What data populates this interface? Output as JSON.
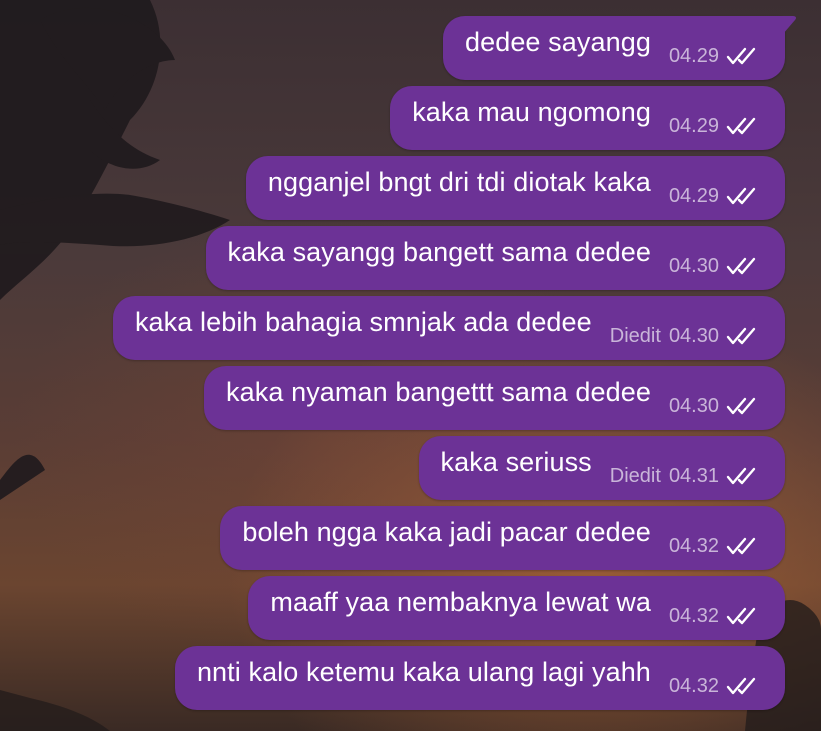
{
  "chat": {
    "read_status_icon": "double-check-icon",
    "bubble_color": "#6c3296",
    "meta_color": "#c9b5d9",
    "messages": [
      {
        "text": "dedee sayangg",
        "time": "04.29",
        "edited": ""
      },
      {
        "text": "kaka mau ngomong",
        "time": "04.29",
        "edited": ""
      },
      {
        "text": "ngganjel bngt dri tdi diotak kaka",
        "time": "04.29",
        "edited": ""
      },
      {
        "text": "kaka sayangg bangett sama dedee",
        "time": "04.30",
        "edited": ""
      },
      {
        "text": "kaka lebih bahagia smnjak ada dedee",
        "time": "04.30",
        "edited": "Diedit"
      },
      {
        "text": "kaka nyaman bangettt sama dedee",
        "time": "04.30",
        "edited": ""
      },
      {
        "text": "kaka seriuss",
        "time": "04.31",
        "edited": "Diedit"
      },
      {
        "text": "boleh ngga kaka jadi pacar dedee",
        "time": "04.32",
        "edited": ""
      },
      {
        "text": "maaff yaa nembaknya lewat wa",
        "time": "04.32",
        "edited": ""
      },
      {
        "text": "nnti kalo ketemu kaka ulang lagi yahh",
        "time": "04.32",
        "edited": ""
      }
    ]
  }
}
